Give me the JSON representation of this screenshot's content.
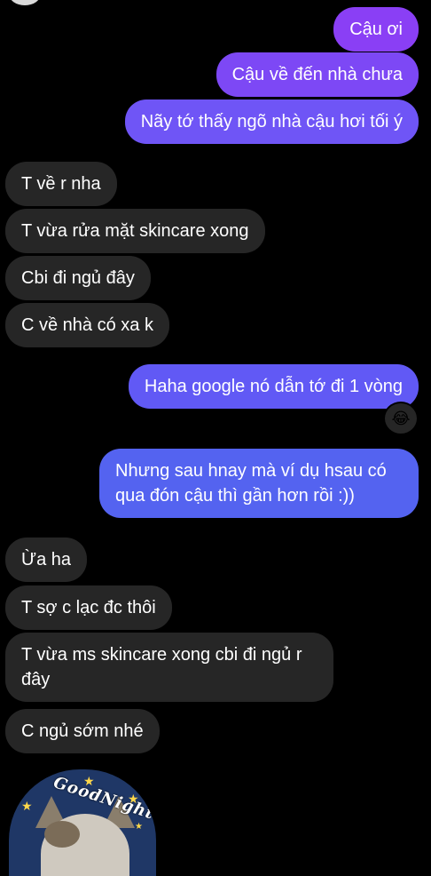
{
  "messages": [
    {
      "side": "sent",
      "text": "Cậu ơi"
    },
    {
      "side": "sent",
      "text": "Cậu về đến nhà chưa"
    },
    {
      "side": "sent",
      "text": "Nãy tớ thấy ngõ nhà cậu hơi tối ý"
    },
    {
      "side": "received",
      "text": "T về r nha"
    },
    {
      "side": "received",
      "text": "T vừa rửa mặt skincare xong"
    },
    {
      "side": "received",
      "text": "Cbi đi ngủ đây"
    },
    {
      "side": "received",
      "text": "C về nhà có xa k"
    },
    {
      "side": "sent",
      "text": "Haha google nó dẫn tớ đi 1 vòng"
    },
    {
      "side": "sent",
      "text": "Nhưng sau hnay mà ví dụ hsau có qua đón cậu thì gần hơn rồi :))"
    },
    {
      "side": "received",
      "text": "Ừa ha"
    },
    {
      "side": "received",
      "text": "T sợ c lạc đc thôi"
    },
    {
      "side": "received",
      "text": "T vừa ms skincare xong cbi đi ngủ r đây"
    },
    {
      "side": "received",
      "text": "C ngủ sớm nhé"
    }
  ],
  "reaction": {
    "emoji": "😂",
    "icon": "laughing-face-icon"
  },
  "sticker": {
    "text": "GoodNight",
    "icon": "goodnight-cat-sticker"
  },
  "colors": {
    "background": "#000000",
    "received_bubble": "#262626",
    "sent_gradient": [
      "#8a3ff5",
      "#5463f0"
    ]
  }
}
